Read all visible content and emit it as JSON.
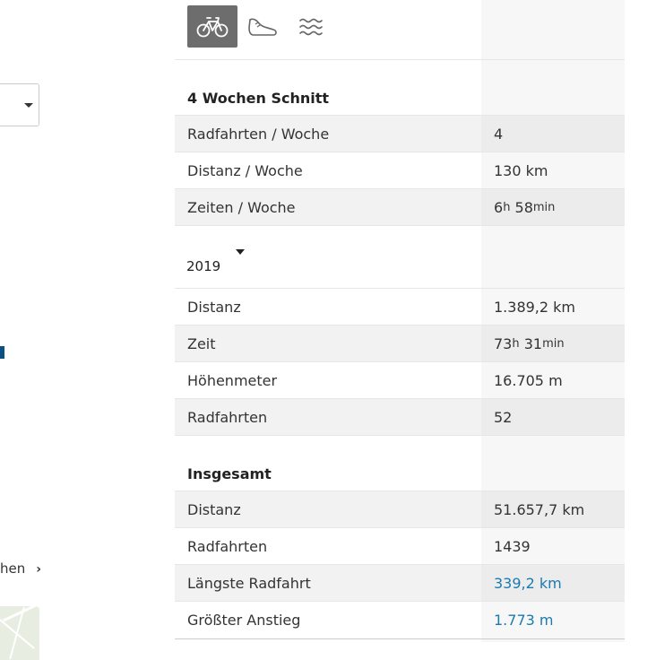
{
  "left": {
    "link_text": "hen"
  },
  "sport_tabs": [
    {
      "name": "bike-icon",
      "active": true
    },
    {
      "name": "shoe-icon",
      "active": false
    },
    {
      "name": "swim-icon",
      "active": false
    }
  ],
  "four_weeks": {
    "title": "4 Wochen Schnitt",
    "rows": [
      {
        "label": "Radfahrten / Woche",
        "value": "4"
      },
      {
        "label": "Distanz / Woche",
        "value": "130 km"
      },
      {
        "label": "Zeiten / Woche",
        "hours": "6",
        "minutes": "58"
      }
    ]
  },
  "year": {
    "selected": "2019",
    "rows": [
      {
        "label": "Distanz",
        "value": "1.389,2 km"
      },
      {
        "label": "Zeit",
        "hours": "73",
        "minutes": "31"
      },
      {
        "label": "Höhenmeter",
        "value": "16.705 m"
      },
      {
        "label": "Radfahrten",
        "value": "52"
      }
    ]
  },
  "total": {
    "title": "Insgesamt",
    "rows": [
      {
        "label": "Distanz",
        "value": "51.657,7 km"
      },
      {
        "label": "Radfahrten",
        "value": "1439"
      },
      {
        "label": "Längste Radfahrt",
        "value": "339,2 km"
      },
      {
        "label": "Größter Anstieg",
        "value": "1.773 m"
      }
    ]
  },
  "units": {
    "h": "h",
    "min": "min"
  },
  "colors": {
    "link": "#1a7bb0",
    "active_tab": "#6d6d6d"
  }
}
